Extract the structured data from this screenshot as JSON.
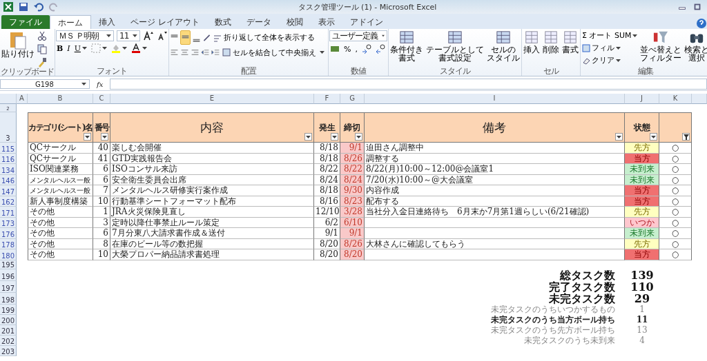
{
  "window": {
    "title": "タスク管理ツール (1)  -  Microsoft Excel"
  },
  "tabs": [
    {
      "label": "ファイル",
      "selected": false,
      "kind": "file"
    },
    {
      "label": "ホーム",
      "selected": true,
      "kind": "tab"
    },
    {
      "label": "挿入",
      "selected": false,
      "kind": "tab"
    },
    {
      "label": "ページ レイアウト",
      "selected": false,
      "kind": "tab"
    },
    {
      "label": "数式",
      "selected": false,
      "kind": "tab"
    },
    {
      "label": "データ",
      "selected": false,
      "kind": "tab"
    },
    {
      "label": "校閲",
      "selected": false,
      "kind": "tab"
    },
    {
      "label": "表示",
      "selected": false,
      "kind": "tab"
    },
    {
      "label": "アドイン",
      "selected": false,
      "kind": "tab"
    }
  ],
  "ribbon": {
    "clipboard": {
      "paste": "貼り付け",
      "label": "クリップボード"
    },
    "font": {
      "name": "ＭＳ Ｐ明朝",
      "size": "11",
      "bold": "B",
      "italic": "I",
      "underline": "U",
      "label": "フォント"
    },
    "alignment": {
      "wrap": "折り返して全体を表示する",
      "merge": "セルを結合して中央揃え",
      "label": "配置"
    },
    "number": {
      "format": "ユーザー定義",
      "percent": "%",
      "comma": ",",
      "label": "数値"
    },
    "styles": {
      "buttons": [
        [
          "条件付き",
          "書式"
        ],
        [
          "テーブルとして",
          "書式設定"
        ],
        [
          "セルの",
          "スタイル"
        ]
      ],
      "label": "スタイル"
    },
    "cells": {
      "buttons": [
        "挿入",
        "削除",
        "書式"
      ],
      "label": "セル"
    },
    "editing": {
      "autosum": "Σ オート SUM",
      "fill": "フィル",
      "clear": "クリア",
      "sort": [
        "並べ替えと",
        "フィルター"
      ],
      "find": [
        "検索と",
        "選択"
      ],
      "label": "編集"
    }
  },
  "formula_bar": {
    "name_box": "G198",
    "fx": "fx"
  },
  "columns": [
    "A",
    "B",
    "C",
    "E",
    "F",
    "G",
    "I",
    "J",
    "K"
  ],
  "header_row": {
    "row": "3",
    "small_row": "2",
    "cells": [
      {
        "text": "カテゴリ(シート)名",
        "filtered": false
      },
      {
        "text": "番号",
        "filtered": false
      },
      {
        "text": "内容",
        "filtered": false
      },
      {
        "text": "発生",
        "filtered": false
      },
      {
        "text": "締切",
        "filtered": false
      },
      {
        "text": "備考",
        "filtered": false
      },
      {
        "text": "状態",
        "filtered": false
      },
      {
        "text": "",
        "filtered": true
      }
    ]
  },
  "rows": [
    {
      "row": "115",
      "category": "QCサークル",
      "number": "40",
      "content": "楽しむ会開催",
      "occurred": "8/18",
      "deadline": "9/1",
      "note": "迫田さん調整中",
      "status": "先方",
      "kind": "theirs",
      "mark": "○"
    },
    {
      "row": "116",
      "category": "QCサークル",
      "number": "41",
      "content": "GTD実践報告会",
      "occurred": "8/18",
      "deadline": "8/26",
      "note": "調整する",
      "status": "当方",
      "kind": "ours",
      "mark": "○"
    },
    {
      "row": "134",
      "category": "ISO関連業務",
      "number": "6",
      "content": "ISOコンサル来訪",
      "occurred": "8/22",
      "deadline": "8/22",
      "note": "8/22(月)10:00～12:00@会議室1",
      "status": "未到来",
      "kind": "pending",
      "mark": "○"
    },
    {
      "row": "146",
      "category": "メンタルヘルス一般",
      "number": "6",
      "content": "安全衛生委員会出席",
      "occurred": "8/24",
      "deadline": "8/24",
      "note": "7/20(水)10:00～@大会議室",
      "status": "未到来",
      "kind": "pending",
      "mark": "○"
    },
    {
      "row": "147",
      "category": "メンタルヘルス一般",
      "number": "7",
      "content": "メンタルヘルス研修実行案作成",
      "occurred": "8/18",
      "deadline": "9/30",
      "note": "内容作成",
      "status": "当方",
      "kind": "ours",
      "mark": "○"
    },
    {
      "row": "162",
      "category": "新人事制度構築",
      "number": "10",
      "content": "行動基準シートフォーマット配布",
      "occurred": "8/16",
      "deadline": "8/23",
      "note": "配布する",
      "status": "当方",
      "kind": "ours",
      "mark": "○"
    },
    {
      "row": "171",
      "category": "その他",
      "number": "1",
      "content": "JRA火災保険見直し",
      "occurred": "12/10",
      "deadline": "3/28",
      "note": "当社分入金日連絡待ち　6月末か7月第1週らしい(6/21確認)",
      "status": "先方",
      "kind": "theirs",
      "mark": "○"
    },
    {
      "row": "173",
      "category": "その他",
      "number": "3",
      "content": "定時以降仕事禁止ルール策定",
      "occurred": "6/2",
      "deadline": "6/10",
      "note": "",
      "status": "いつか",
      "kind": "someday",
      "mark": "○"
    },
    {
      "row": "176",
      "category": "その他",
      "number": "6",
      "content": "7月分東八大請求書作成＆送付",
      "occurred": "9/1",
      "deadline": "9/1",
      "note": "",
      "status": "未到来",
      "kind": "pending",
      "mark": "○"
    },
    {
      "row": "178",
      "category": "その他",
      "number": "8",
      "content": "在庫のビール等の数把握",
      "occurred": "8/20",
      "deadline": "8/26",
      "note": "大林さんに確認してもらう",
      "status": "先方",
      "kind": "theirs",
      "mark": "○"
    },
    {
      "row": "180",
      "category": "その他",
      "number": "10",
      "content": "大榮プロパー納品請求書処理",
      "occurred": "8/20",
      "deadline": "8/20",
      "note": "",
      "status": "当方",
      "kind": "ours",
      "mark": "○"
    }
  ],
  "blank_row": "195",
  "summary": [
    {
      "row": "196",
      "label": "総タスク数",
      "value": "139",
      "kind": "major",
      "emphasized": true
    },
    {
      "row": "197",
      "label": "完了タスク数",
      "value": "110",
      "kind": "major",
      "emphasized": true
    },
    {
      "row": "198",
      "label": "未完タスク数",
      "value": "29",
      "kind": "major",
      "emphasized": true
    },
    {
      "row": "199",
      "label": "未完タスクのうちいつかするもの",
      "value": "1",
      "kind": "minor",
      "emphasized": false
    },
    {
      "row": "200",
      "label": "未完タスクのうち当方ボール持ち",
      "value": "11",
      "kind": "minor",
      "emphasized": true
    },
    {
      "row": "201",
      "label": "未完タスクのうち先方ボール持ち",
      "value": "13",
      "kind": "minor",
      "emphasized": false
    },
    {
      "row": "202",
      "label": "未完タスクのうち未到来",
      "value": "4",
      "kind": "minor",
      "emphasized": false
    }
  ],
  "trailing_row": "203"
}
